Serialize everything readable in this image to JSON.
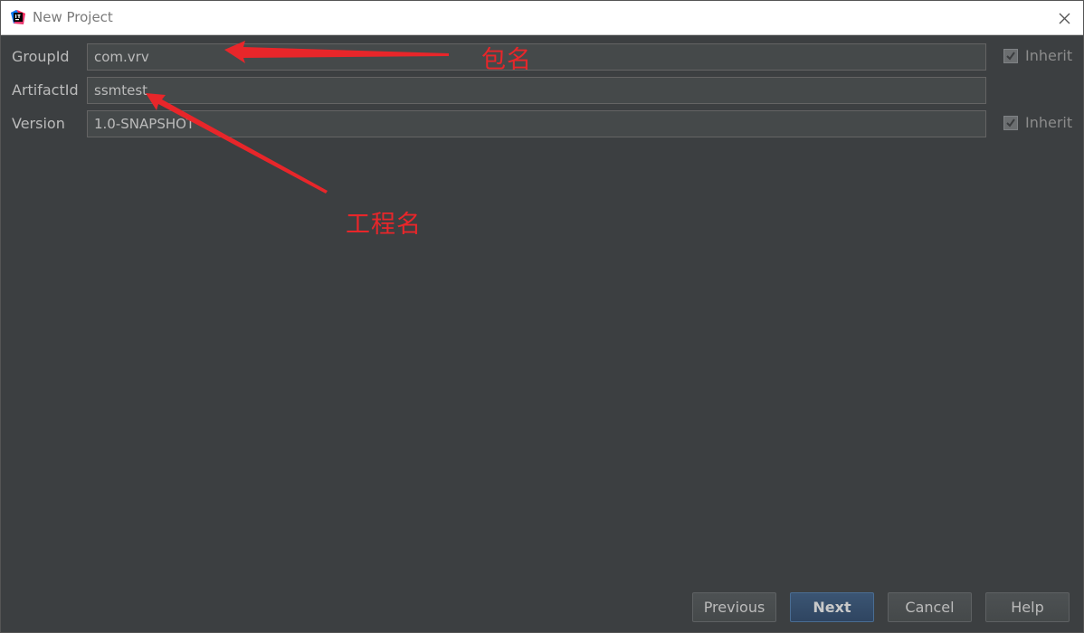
{
  "window": {
    "title": "New Project"
  },
  "form": {
    "group_id": {
      "label": "GroupId",
      "value": "com.vrv",
      "inherit_label": "Inherit",
      "inherit_checked": true
    },
    "artifact_id": {
      "label": "ArtifactId",
      "value": "ssmtest"
    },
    "version": {
      "label": "Version",
      "value": "1.0-SNAPSHOT",
      "inherit_label": "Inherit",
      "inherit_checked": true
    }
  },
  "annotations": {
    "package_name": "包名",
    "project_name": "工程名"
  },
  "buttons": {
    "previous": "Previous",
    "next": "Next",
    "cancel": "Cancel",
    "help": "Help"
  },
  "colors": {
    "background": "#3c3f41",
    "annotation": "#e8262a",
    "primary_button": "#2f4561"
  },
  "icons": {
    "app": "intellij-idea-icon",
    "close": "close-icon",
    "check": "checkmark-icon"
  }
}
